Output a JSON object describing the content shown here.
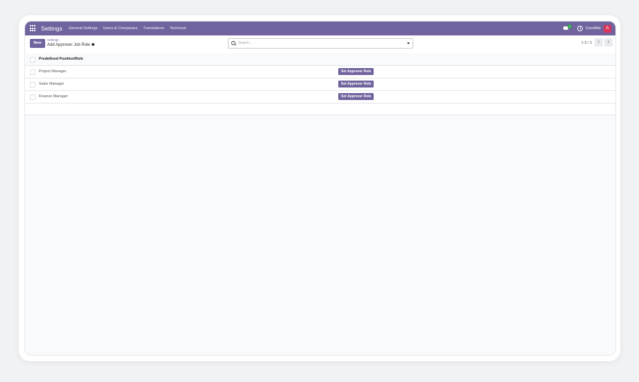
{
  "navbar": {
    "app_title": "Settings",
    "menu": [
      "General Settings",
      "Users & Companies",
      "Translations",
      "Technical"
    ],
    "message_count": "1",
    "company": "CoreBite",
    "avatar_letter": "A",
    "accent": "#71639e"
  },
  "control": {
    "new_label": "New",
    "breadcrumb_parent": "Settings",
    "breadcrumb_current": "Add Approver Job Role",
    "search_placeholder": "Search...",
    "pager": "1-3 / 3",
    "prev": "‹",
    "next": "›"
  },
  "table": {
    "column": "Predefined Position/Role",
    "rows": [
      {
        "name": "Project Manager",
        "action": "Set Approver Role"
      },
      {
        "name": "Sales Manager",
        "action": "Set Approver Role"
      },
      {
        "name": "Finance Manager",
        "action": "Set Approver Role"
      }
    ]
  }
}
